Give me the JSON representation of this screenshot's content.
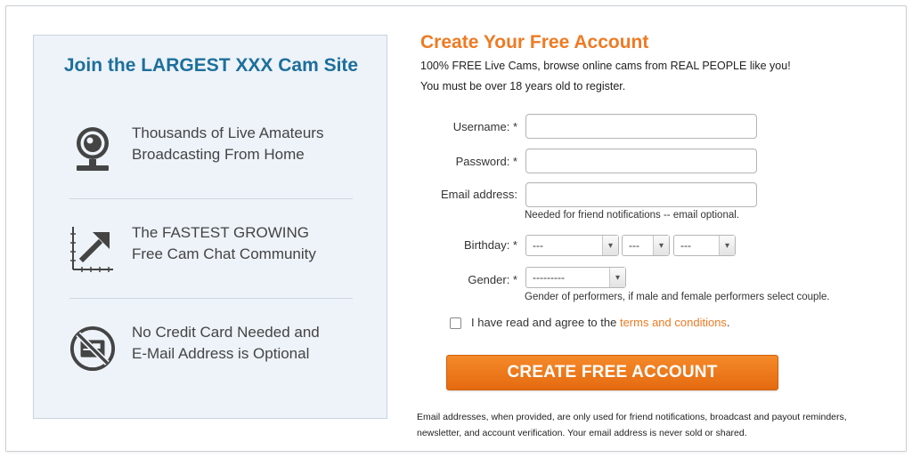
{
  "left": {
    "title": "Join the LARGEST XXX Cam Site",
    "features": [
      {
        "icon": "webcam-icon",
        "line1": "Thousands of Live Amateurs",
        "line2": "Broadcasting From Home"
      },
      {
        "icon": "growth-arrow-icon",
        "line1": "The FASTEST GROWING",
        "line2": "Free Cam Chat Community"
      },
      {
        "icon": "no-credit-card-icon",
        "line1": "No Credit Card Needed and",
        "line2": "E-Mail Address is Optional"
      }
    ]
  },
  "form": {
    "title": "Create Your Free Account",
    "intro1": "100% FREE Live Cams, browse online cams from REAL PEOPLE like you!",
    "intro2": "You must be over 18 years old to register.",
    "username_label": "Username: *",
    "username_value": "",
    "password_label": "Password: *",
    "password_value": "",
    "email_label": "Email address:",
    "email_value": "",
    "email_hint": "Needed for friend notifications -- email optional.",
    "birthday_label": "Birthday: *",
    "birthday_month": "---",
    "birthday_day": "---",
    "birthday_year": "---",
    "gender_label": "Gender: *",
    "gender_value": "---------",
    "gender_hint": "Gender of performers, if male and female performers select couple.",
    "agree_text": "I have read and agree to the ",
    "agree_link": "terms and conditions",
    "agree_end": ".",
    "agree_checked": false,
    "submit_label": "CREATE FREE ACCOUNT",
    "footer": "Email addresses, when provided, are only used for friend notifications, broadcast and payout reminders, newsletter, and account verification. Your email address is never sold or shared."
  },
  "colors": {
    "accent_orange": "#ef7a23",
    "title_blue": "#1d6f9b",
    "panel_bg": "#edf3f9"
  }
}
